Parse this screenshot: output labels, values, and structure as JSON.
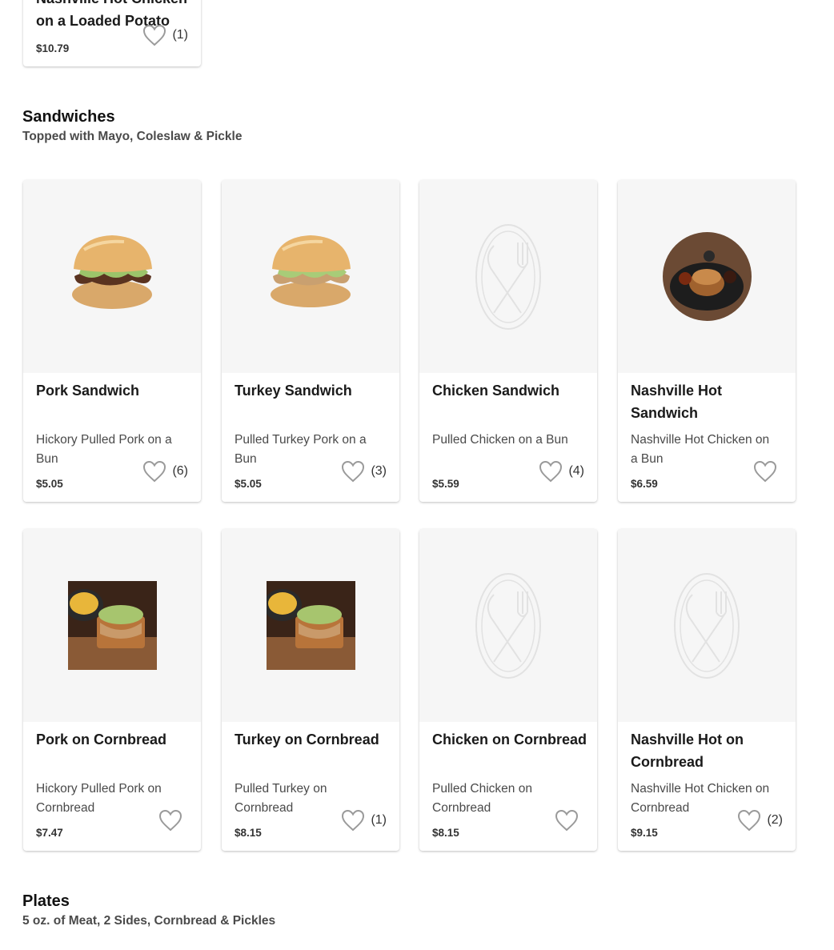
{
  "top_card": {
    "name": "Nashville Hot Chicken on a Loaded Potato",
    "price": "$10.79",
    "fav_count": "(1)"
  },
  "sections": [
    {
      "title": "Sandwiches",
      "subtitle": "Topped with Mayo, Coleslaw & Pickle",
      "items": [
        {
          "name": "Pork Sandwich",
          "desc": "Hickory Pulled Pork on a Bun",
          "price": "$5.05",
          "fav_count": "(6)",
          "image": "sandwich-photo"
        },
        {
          "name": "Turkey Sandwich",
          "desc": "Pulled Turkey Pork on a Bun",
          "price": "$5.05",
          "fav_count": "(3)",
          "image": "sandwich-photo"
        },
        {
          "name": "Chicken Sandwich",
          "desc": "Pulled Chicken on a Bun",
          "price": "$5.59",
          "fav_count": "(4)",
          "image": "placeholder-utensils"
        },
        {
          "name": "Nashville Hot Sandwich",
          "desc": "Nashville Hot Chicken on a Bun",
          "price": "$6.59",
          "fav_count": "",
          "image": "plated-sandwich-photo"
        },
        {
          "name": "Pork on Cornbread",
          "desc": "Hickory Pulled Pork on Cornbread",
          "price": "$7.47",
          "fav_count": "",
          "image": "cornbread-photo"
        },
        {
          "name": "Turkey on Cornbread",
          "desc": "Pulled Turkey on Cornbread",
          "price": "$8.15",
          "fav_count": "(1)",
          "image": "cornbread-photo"
        },
        {
          "name": "Chicken on Cornbread",
          "desc": "Pulled Chicken on Cornbread",
          "price": "$8.15",
          "fav_count": "",
          "image": "placeholder-utensils"
        },
        {
          "name": "Nashville Hot on Cornbread",
          "desc": "Nashville Hot Chicken on Cornbread",
          "price": "$9.15",
          "fav_count": "(2)",
          "image": "placeholder-utensils"
        }
      ]
    },
    {
      "title": "Plates",
      "subtitle": "5 oz. of Meat, 2 Sides, Cornbread & Pickles",
      "items": []
    }
  ],
  "colors": {
    "image_bg": "#f6f6f6",
    "placeholder_stroke": "#e2e2e2",
    "heart_stroke": "#9a9a9a"
  }
}
